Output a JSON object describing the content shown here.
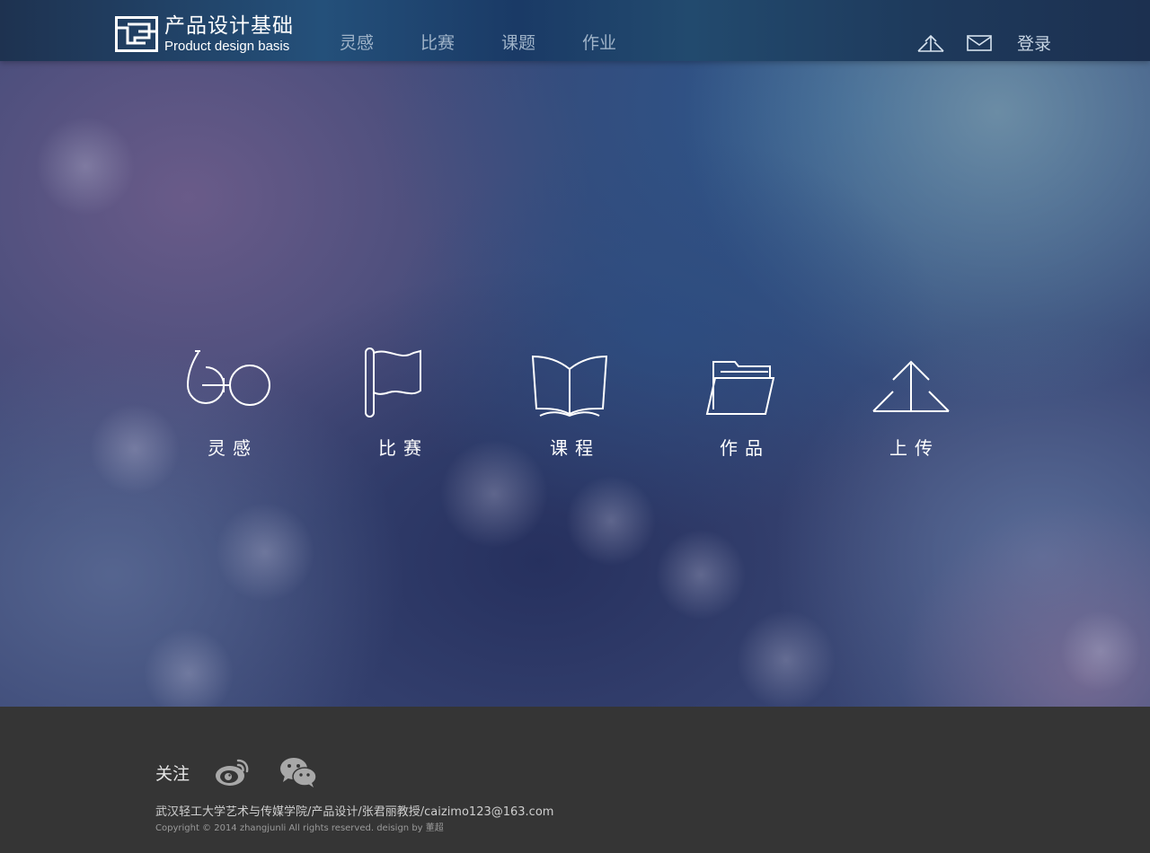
{
  "header": {
    "logo": {
      "title_cn": "产品设计基础",
      "title_en": "Product design basis",
      "mark_icon": "maze-square-logo"
    },
    "nav": [
      "灵感",
      "比赛",
      "课题",
      "作业"
    ],
    "actions": {
      "upload_icon": "upload-arrow-icon",
      "mail_icon": "mail-icon",
      "login_label": "登录"
    }
  },
  "categories": [
    {
      "label": "灵感",
      "icon": "glasses-icon"
    },
    {
      "label": "比赛",
      "icon": "flag-icon"
    },
    {
      "label": "课程",
      "icon": "open-book-icon"
    },
    {
      "label": "作品",
      "icon": "folder-icon"
    },
    {
      "label": "上传",
      "icon": "upload-arrow-icon"
    }
  ],
  "footer": {
    "follow_label": "关注",
    "social": [
      {
        "icon": "weibo-icon"
      },
      {
        "icon": "wechat-icon"
      }
    ],
    "contact": "武汉轻工大学艺术与传媒学院/产品设计/张君丽教授/caizimo123@163.com",
    "copyright": "Copyright © 2014 zhangjunli All rights reserved.  deisign by 董超"
  },
  "colors": {
    "header_bg": "#1e3a5c",
    "nav_text": "#9fb3c8",
    "hero_base": "#3a4775",
    "footer_bg": "#353535",
    "icon_stroke": "#ffffff"
  }
}
